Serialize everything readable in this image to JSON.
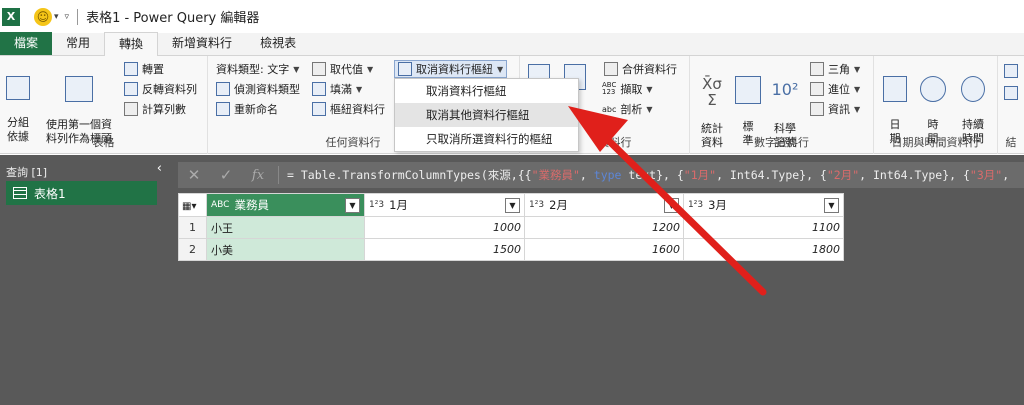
{
  "titlebar": {
    "logo": "X",
    "quick_access": "☺",
    "qa_caret": "▾",
    "customize": "▿",
    "title": "表格1 - Power Query 編輯器"
  },
  "tabs": [
    {
      "label": "檔案"
    },
    {
      "label": "常用"
    },
    {
      "label": "轉換"
    },
    {
      "label": "新增資料行"
    },
    {
      "label": "檢視表"
    }
  ],
  "ribbon": {
    "table_group": {
      "label": "表格",
      "group_by": "分組\n依據",
      "first_row_headers": "使用第一個資\n料列作為標頭",
      "transpose": "轉置",
      "reverse_rows": "反轉資料列",
      "count_rows": "計算列數"
    },
    "any_column_group": {
      "label": "任何資料行",
      "data_type": "資料類型: 文字",
      "detect_type": "偵測資料類型",
      "rename": "重新命名",
      "replace_values": "取代值",
      "fill": "填滿",
      "pivot_column": "樞紐資料行",
      "unpivot_columns": "取消資料行樞紐"
    },
    "text_column_group": {
      "label": "資料行",
      "merge_columns": "合併資料行",
      "extract": "擷取",
      "parse": "剖析",
      "extract_icon": "ABC\n123",
      "parse_icon": "abc"
    },
    "number_column_group": {
      "label": "數字資料行",
      "statistics": "統計\n資料",
      "standard": "標\n準",
      "scientific": "科學\n記號",
      "trig": "三角",
      "rounding": "進位",
      "info": "資訊"
    },
    "datetime_group": {
      "label": "日期與時間資料行",
      "date": "日\n期",
      "time": "時\n間",
      "duration": "持續\n時間"
    },
    "next_group_label": "結"
  },
  "dropdown_menu": {
    "items": [
      {
        "label": "取消資料行樞紐"
      },
      {
        "label": "取消其他資料行樞紐"
      },
      {
        "label": "只取消所選資料行的樞紐"
      }
    ]
  },
  "queries_pane": {
    "header": "查詢 [1]",
    "collapse": "‹",
    "items": [
      {
        "label": "表格1"
      }
    ]
  },
  "formula_bar": {
    "cancel": "✕",
    "confirm": "✓",
    "fx": "fx",
    "formula_parts": [
      {
        "t": "= Table.TransformColumnTypes(來源,{{",
        "c": ""
      },
      {
        "t": "\"業務員\"",
        "c": "s"
      },
      {
        "t": ", ",
        "c": ""
      },
      {
        "t": "type",
        "c": "k"
      },
      {
        "t": " text}, {",
        "c": ""
      },
      {
        "t": "\"1月\"",
        "c": "s"
      },
      {
        "t": ", Int64.Type}, {",
        "c": ""
      },
      {
        "t": "\"2月\"",
        "c": "s"
      },
      {
        "t": ", Int64.Type}, {",
        "c": ""
      },
      {
        "t": "\"3月\"",
        "c": "s"
      },
      {
        "t": ",",
        "c": ""
      }
    ]
  },
  "grid": {
    "corner_icon": "▦▾",
    "columns": [
      {
        "type_icon": "ABC",
        "name": "業務員"
      },
      {
        "type_icon": "1²3",
        "name": "1月"
      },
      {
        "type_icon": "1²3",
        "name": "2月"
      },
      {
        "type_icon": "1²3",
        "name": "3月"
      }
    ],
    "rows": [
      {
        "no": "1",
        "cells": [
          "小王",
          "1000",
          "1200",
          "1100"
        ]
      },
      {
        "no": "2",
        "cells": [
          "小美",
          "1500",
          "1600",
          "1800"
        ]
      }
    ]
  },
  "colors": {
    "brand": "#217346",
    "annotation_arrow": "#e0201b"
  }
}
